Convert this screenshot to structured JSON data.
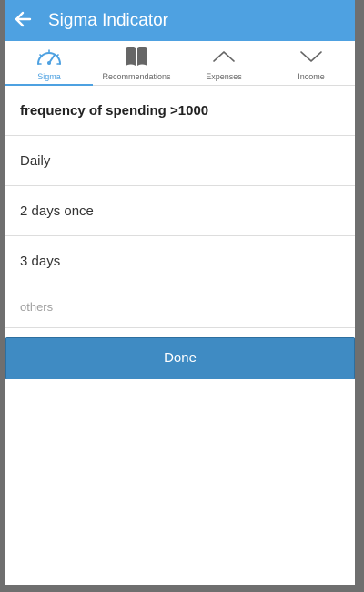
{
  "header": {
    "title": "Sigma Indicator",
    "back_icon": "arrow-left-icon",
    "background_color": "#4ea1e1"
  },
  "tabs": [
    {
      "label": "Sigma",
      "icon": "speedometer-icon",
      "active": true
    },
    {
      "label": "Recommendations",
      "icon": "book-icon",
      "active": false
    },
    {
      "label": "Expenses",
      "icon": "chevron-up-icon",
      "active": false
    },
    {
      "label": "Income",
      "icon": "chevron-down-icon",
      "active": false
    }
  ],
  "question": {
    "text": "frequency of spending >1000"
  },
  "options": [
    {
      "label": "Daily"
    },
    {
      "label": "2 days once"
    },
    {
      "label": "3 days"
    }
  ],
  "others": {
    "placeholder": "others",
    "value": ""
  },
  "done_button": {
    "label": "Done",
    "color": "#3f8bc3"
  }
}
